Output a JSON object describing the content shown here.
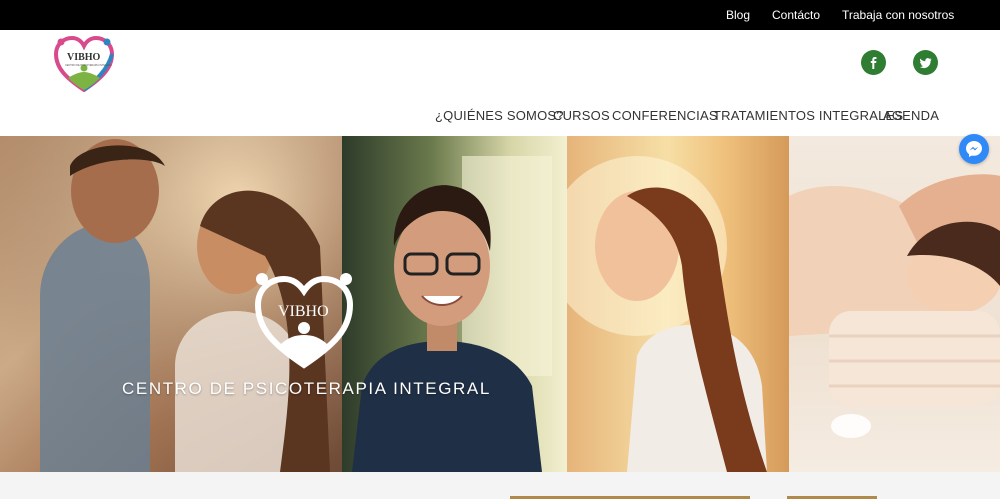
{
  "topbar": {
    "links": [
      {
        "label": "Blog"
      },
      {
        "label": "Contácto"
      },
      {
        "label": "Trabaja con nosotros"
      }
    ],
    "background": "#000000"
  },
  "header": {
    "logo": {
      "text": "VIBHO",
      "tagline": "CENTRO DE PSICOTERAPIA INTEGRAL"
    },
    "social": [
      {
        "icon": "facebook-icon"
      },
      {
        "icon": "twitter-icon"
      }
    ],
    "social_color": "#2e7d32",
    "nav": [
      {
        "label": "¿QUIÉNES SOMOS?"
      },
      {
        "label": "CURSOS"
      },
      {
        "label": "CONFERENCIAS"
      },
      {
        "label": "TRATAMIENTOS INTEGRALES"
      },
      {
        "label": "AGENDA"
      }
    ]
  },
  "hero": {
    "logo_text": "VIBHO",
    "title": "CENTRO DE PSICOTERAPIA INTEGRAL"
  },
  "messenger": {
    "icon": "messenger-icon",
    "color": "#2f8af7"
  }
}
